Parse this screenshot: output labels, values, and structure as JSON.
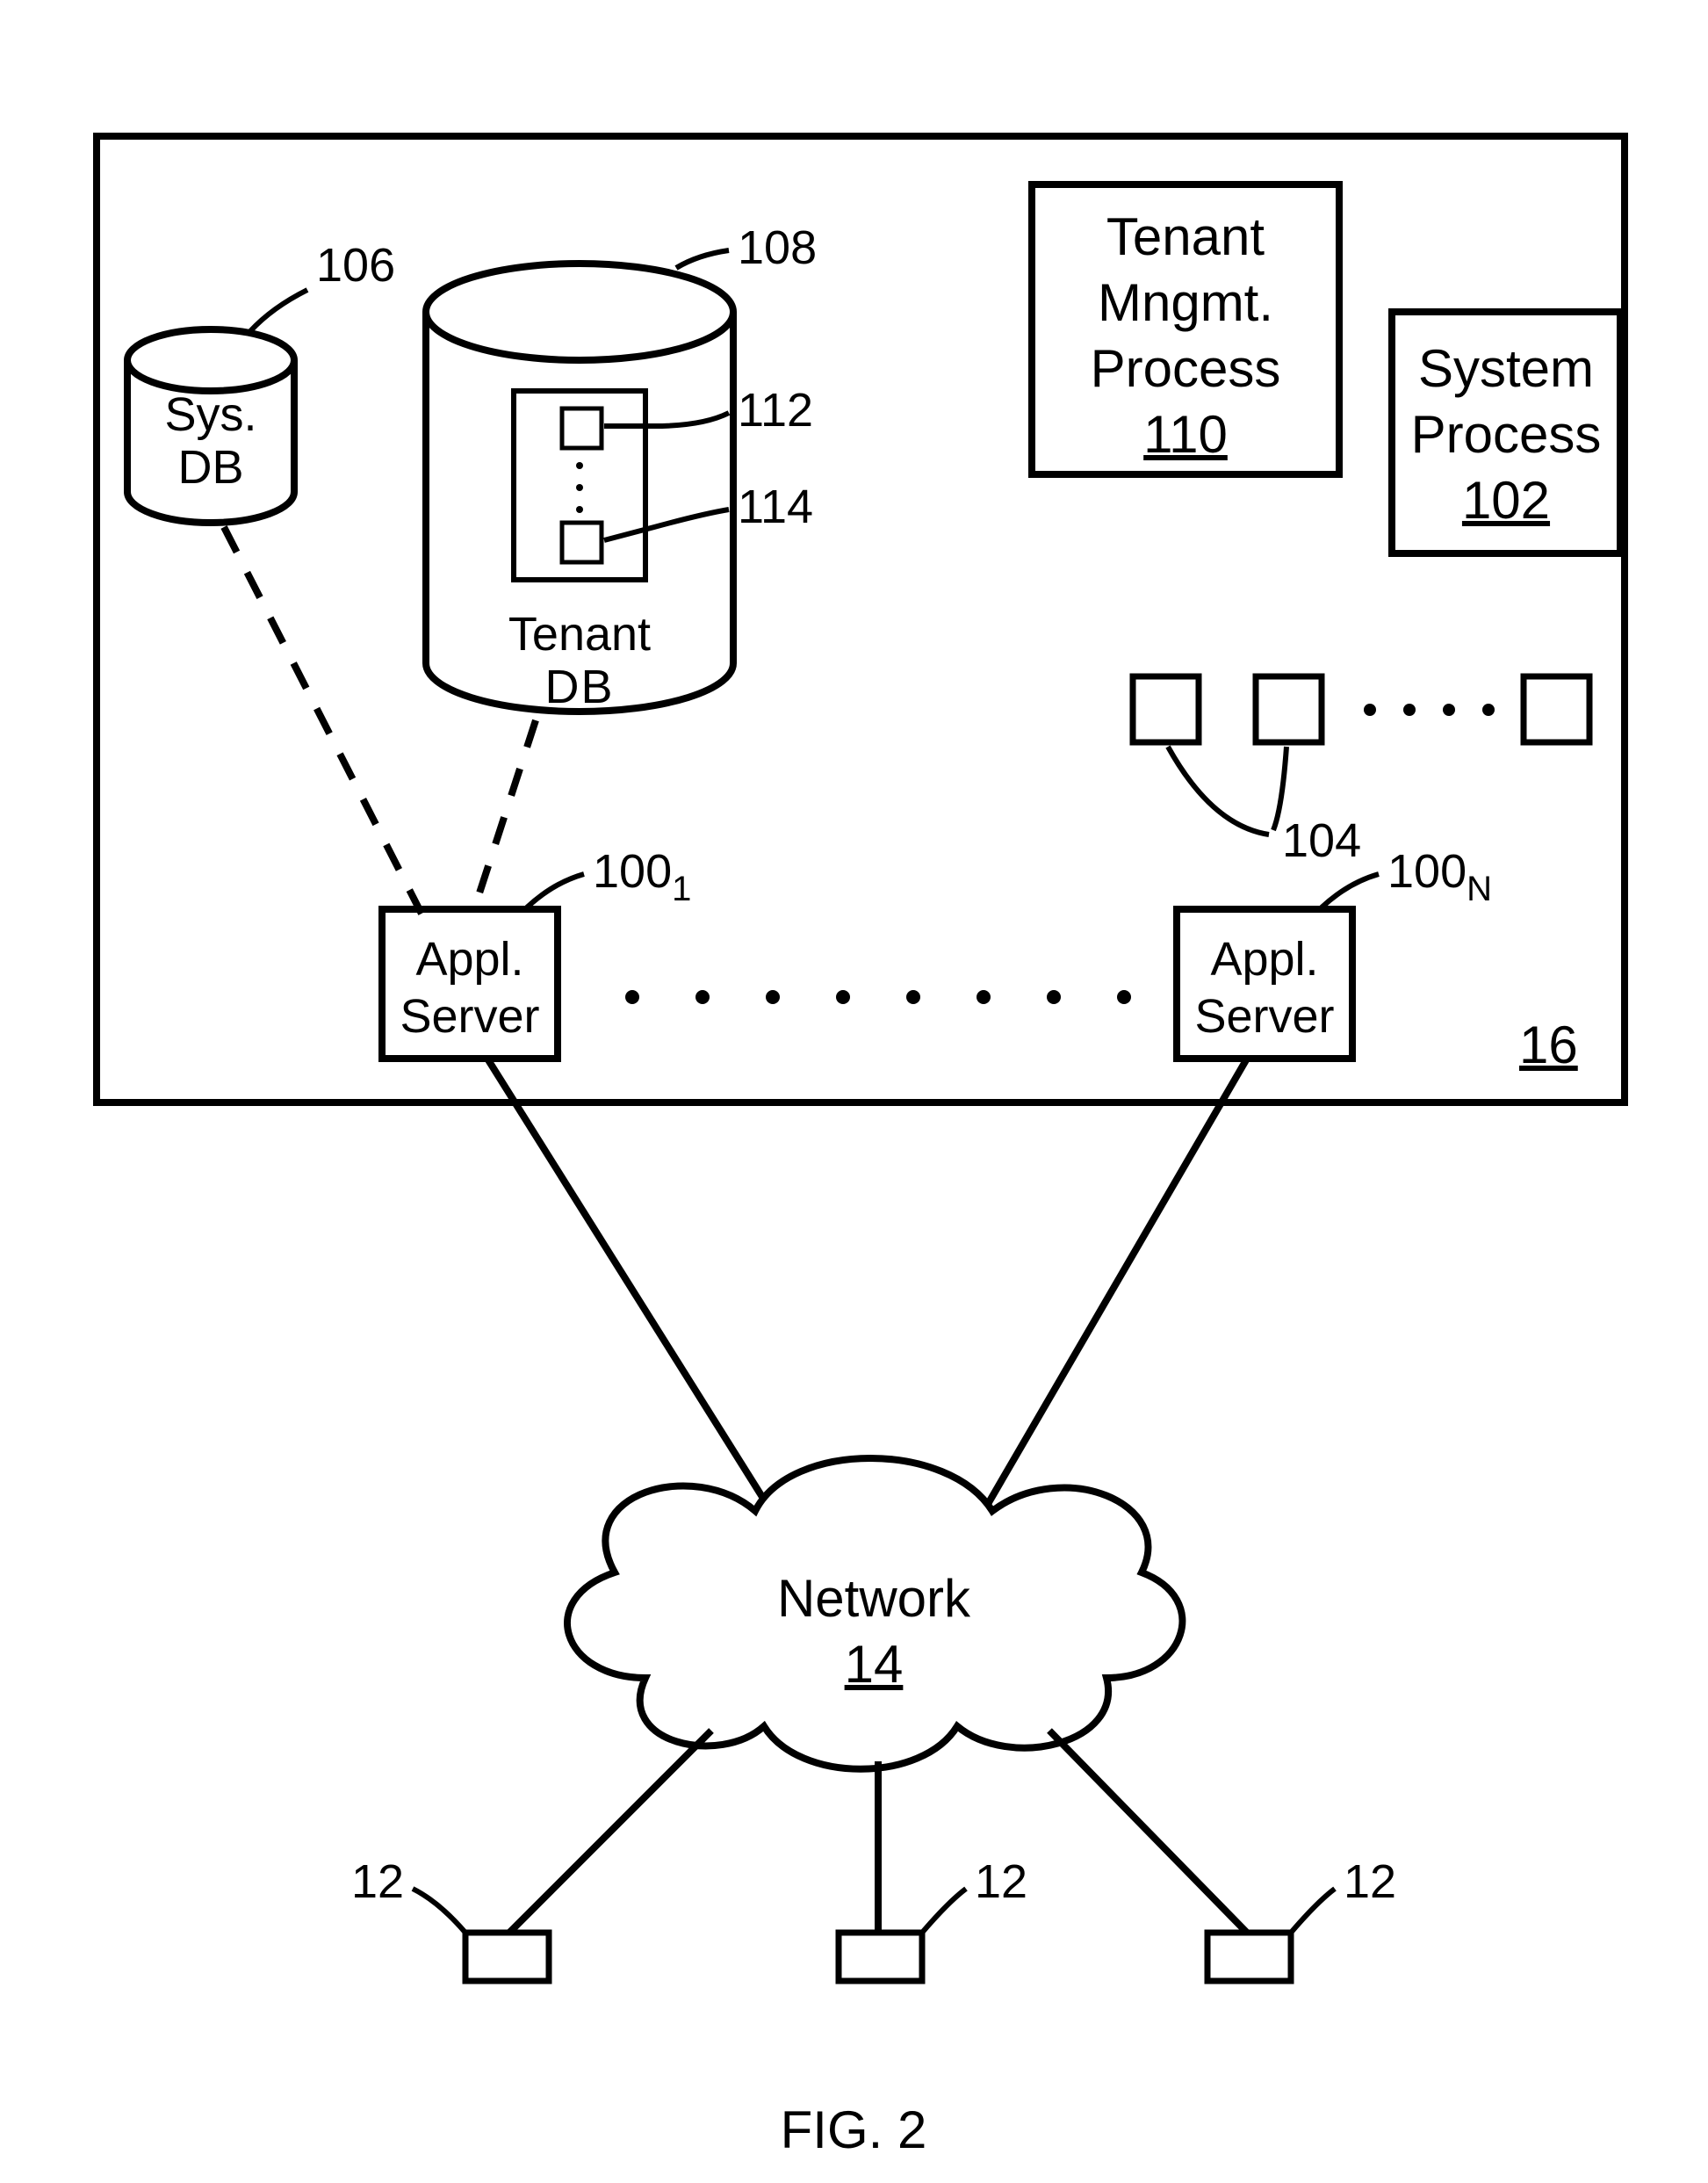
{
  "figure": {
    "caption": "FIG. 2",
    "systemRef": "16",
    "sysDb": {
      "label1": "Sys.",
      "label2": "DB",
      "ref": "106"
    },
    "tenantDb": {
      "label1": "Tenant",
      "label2": "DB",
      "ref": "108",
      "box1Ref": "112",
      "box2Ref": "114"
    },
    "tenantMgmt": {
      "line1": "Tenant",
      "line2": "Mngmt.",
      "line3": "Process",
      "ref": "110"
    },
    "systemProcess": {
      "line1": "System",
      "line2": "Process",
      "ref": "102"
    },
    "group104": {
      "ref": "104"
    },
    "appServer1": {
      "line1": "Appl.",
      "line2": "Server",
      "ref": "100",
      "refSub": "1"
    },
    "appServerN": {
      "line1": "Appl.",
      "line2": "Server",
      "ref": "100",
      "refSub": "N"
    },
    "network": {
      "label": "Network",
      "ref": "14"
    },
    "clientRef": "12"
  }
}
